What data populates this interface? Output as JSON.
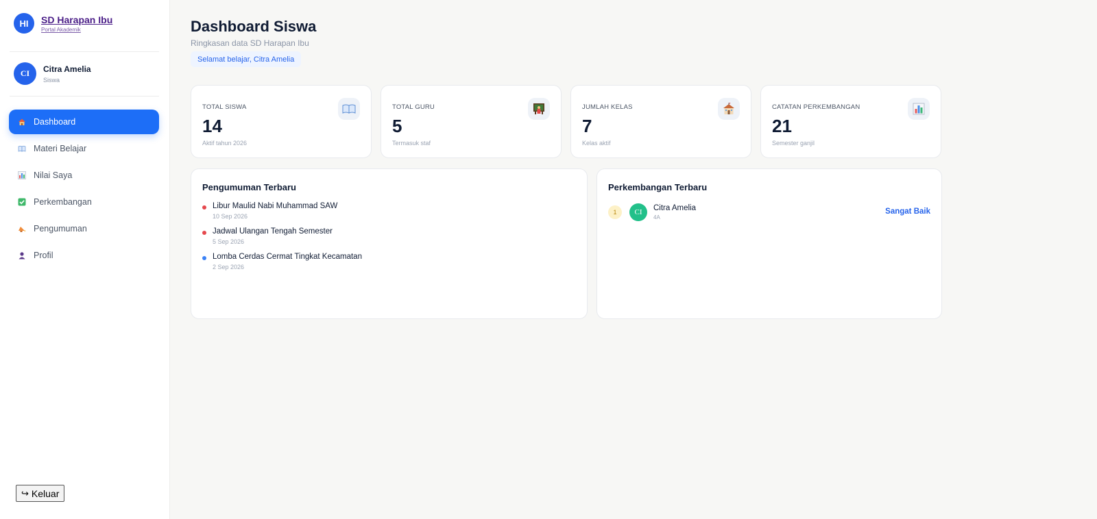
{
  "brand": {
    "initials": "HI",
    "name": "SD Harapan Ibu",
    "subtitle": "Portal Akademik"
  },
  "user": {
    "initials": "CI",
    "name": "Citra Amelia",
    "role": "Siswa"
  },
  "nav": [
    {
      "label": "Dashboard",
      "icon": "house-icon",
      "active": true
    },
    {
      "label": "Materi Belajar",
      "icon": "book-icon",
      "active": false
    },
    {
      "label": "Nilai Saya",
      "icon": "bar-chart-icon",
      "active": false
    },
    {
      "label": "Perkembangan",
      "icon": "check-box-icon",
      "active": false
    },
    {
      "label": "Pengumuman",
      "icon": "megaphone-icon",
      "active": false
    },
    {
      "label": "Profil",
      "icon": "person-icon",
      "active": false
    }
  ],
  "logout": {
    "icon": "↪",
    "label": "Keluar"
  },
  "header": {
    "title": "Dashboard Siswa",
    "subtitle": "Ringkasan data SD Harapan Ibu",
    "welcome": "Selamat belajar, Citra Amelia"
  },
  "stats": [
    {
      "label": "TOTAL SISWA",
      "value": "14",
      "note": "Aktif tahun 2026",
      "icon": "book-icon"
    },
    {
      "label": "TOTAL GURU",
      "value": "5",
      "note": "Termasuk staf",
      "icon": "teacher-board-icon"
    },
    {
      "label": "JUMLAH KELAS",
      "value": "7",
      "note": "Kelas aktif",
      "icon": "school-icon"
    },
    {
      "label": "CATATAN PERKEMBANGAN",
      "value": "21",
      "note": "Semester ganjil",
      "icon": "bar-chart-icon"
    }
  ],
  "announcements": {
    "title": "Pengumuman Terbaru",
    "items": [
      {
        "title": "Libur Maulid Nabi Muhammad SAW",
        "date": "10 Sep 2026",
        "color": "#e5484d"
      },
      {
        "title": "Jadwal Ulangan Tengah Semester",
        "date": "5 Sep 2026",
        "color": "#e5484d"
      },
      {
        "title": "Lomba Cerdas Cermat Tingkat Kecamatan",
        "date": "2 Sep 2026",
        "color": "#3b82f6"
      }
    ]
  },
  "development": {
    "title": "Perkembangan Terbaru",
    "items": [
      {
        "rank": "1",
        "initials": "CI",
        "name": "Citra Amelia",
        "class": "4A",
        "grade": "Sangat Baik"
      }
    ]
  },
  "colors": {
    "accent": "#1d6ef7",
    "success": "#22c08a",
    "danger": "#e5484d"
  }
}
